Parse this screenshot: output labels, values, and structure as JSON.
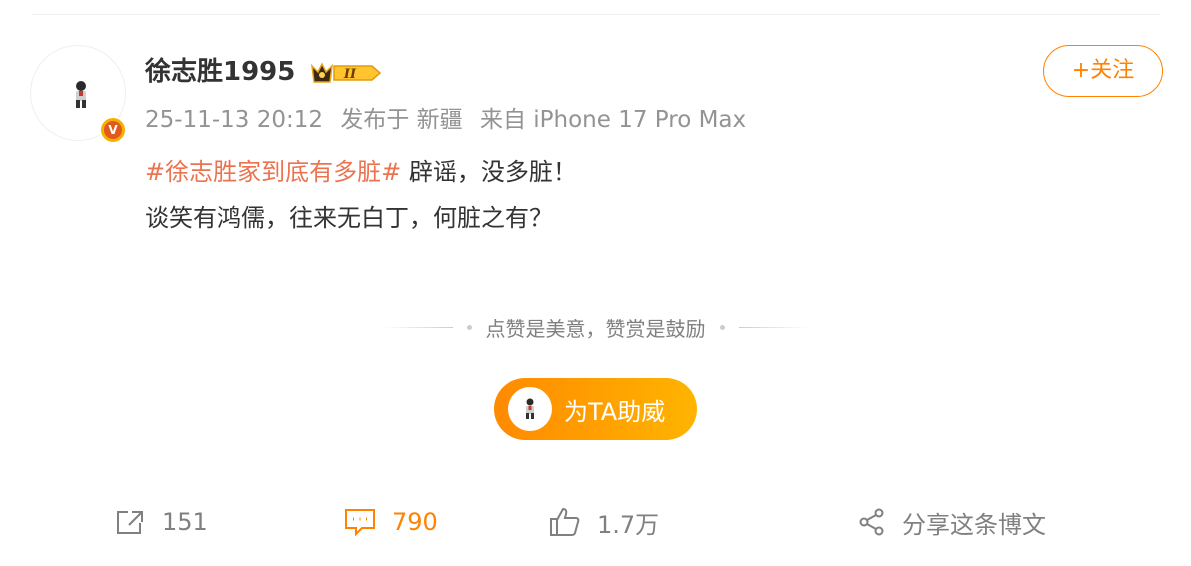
{
  "post": {
    "author": {
      "name": "徐志胜1995",
      "vip_level": "II"
    },
    "meta": {
      "time": "25-11-13 20:12",
      "location": "发布于 新疆",
      "source": "来自 iPhone 17 Pro Max"
    },
    "follow_label": "+关注",
    "content": {
      "hashtag": "#徐志胜家到底有多脏#",
      "line1_text": " 辟谣，没多脏！",
      "line2_text": "谈笑有鸿儒，往来无白丁，何脏之有？"
    },
    "reward": {
      "tagline": "点赞是美意，赞赏是鼓励",
      "support_label": "为TA助威"
    },
    "actions": {
      "repost_count": "151",
      "comment_count": "790",
      "like_count": "1.7万",
      "share_label": "分享这条博文"
    }
  },
  "colors": {
    "accent": "#ff8200",
    "hashtag": "#eb7350",
    "meta_gray": "#939393",
    "verified_badge": "#f6b100"
  },
  "icons": [
    "repost-icon",
    "comment-icon",
    "like-icon",
    "share-icon",
    "verified-icon",
    "crown-vip-icon"
  ]
}
